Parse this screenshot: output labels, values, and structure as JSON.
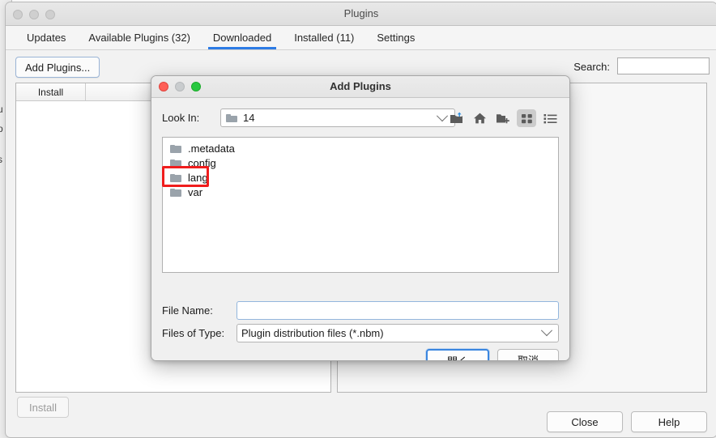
{
  "background_window": {
    "text_fragments": [
      "u",
      "p",
      "i",
      "s"
    ]
  },
  "main_window": {
    "title": "Plugins",
    "traffic_lights": [
      "close",
      "minimize",
      "zoom"
    ],
    "tabs": [
      {
        "label": "Updates",
        "active": false
      },
      {
        "label": "Available Plugins (32)",
        "active": false
      },
      {
        "label": "Downloaded",
        "active": true
      },
      {
        "label": "Installed (11)",
        "active": false
      },
      {
        "label": "Settings",
        "active": false
      }
    ],
    "toolbar": {
      "add_plugins_label": "Add Plugins...",
      "search_label": "Search:",
      "search_value": "",
      "search_placeholder": ""
    },
    "table": {
      "columns": [
        "Install",
        ""
      ],
      "rows": []
    },
    "install_button": "Install",
    "footer_buttons": [
      "Close",
      "Help"
    ],
    "accent_color": "#2c7be5"
  },
  "dialog": {
    "title": "Add Plugins",
    "traffic_lights": [
      "close",
      "minimize",
      "zoom"
    ],
    "look_in": {
      "label": "Look In:",
      "value": "14",
      "icon": "folder-icon"
    },
    "toolbar_icons": [
      {
        "name": "up-one-level-icon",
        "selected": false
      },
      {
        "name": "home-icon",
        "selected": false
      },
      {
        "name": "new-folder-icon",
        "selected": false
      },
      {
        "name": "tile-view-icon",
        "selected": true
      },
      {
        "name": "list-view-icon",
        "selected": false
      }
    ],
    "files": [
      {
        "name": ".metadata",
        "type": "folder",
        "highlighted": false
      },
      {
        "name": "config",
        "type": "folder",
        "highlighted": false
      },
      {
        "name": "lang",
        "type": "folder",
        "highlighted": true
      },
      {
        "name": "var",
        "type": "folder",
        "highlighted": false
      }
    ],
    "file_name": {
      "label": "File Name:",
      "value": "",
      "placeholder": ""
    },
    "files_of_type": {
      "label": "Files of Type:",
      "value": "Plugin distribution files (*.nbm)"
    },
    "buttons": {
      "open": "開く",
      "cancel": "取消"
    },
    "annotation_color": "#f01d1d"
  }
}
